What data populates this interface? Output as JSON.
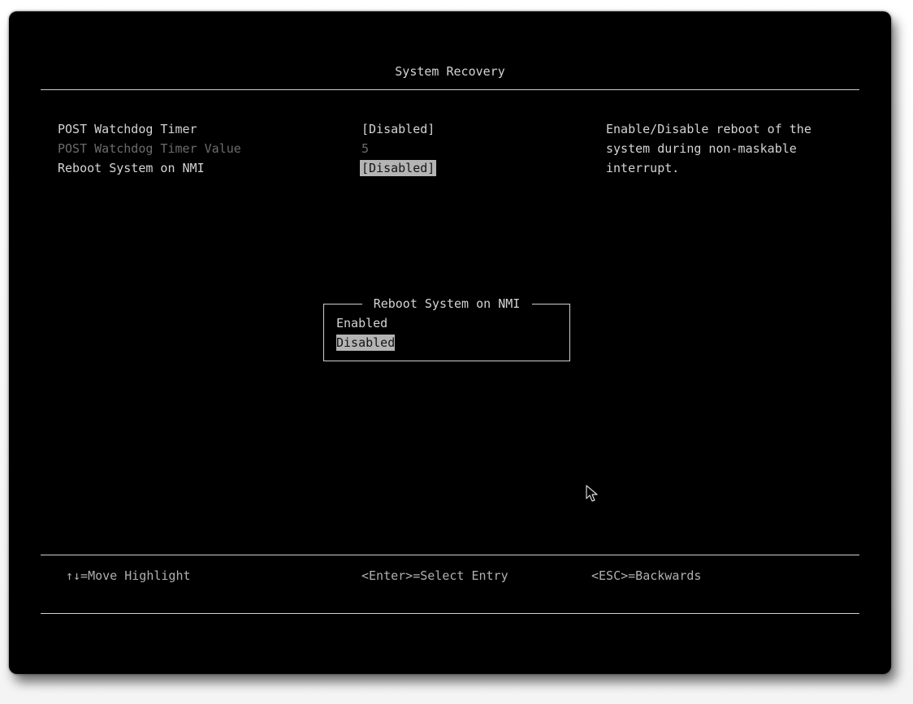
{
  "screen": {
    "title": "System Recovery"
  },
  "settings": [
    {
      "label": "POST Watchdog Timer",
      "value": "[Disabled]",
      "state": "normal"
    },
    {
      "label": "POST Watchdog Timer Value",
      "value": "5",
      "state": "disabled"
    },
    {
      "label": "Reboot System on NMI",
      "value": "[Disabled]",
      "state": "selected"
    }
  ],
  "help": {
    "lines": [
      "Enable/Disable reboot of the",
      "system during non-maskable",
      "interrupt."
    ]
  },
  "popup": {
    "title": "Reboot System on NMI",
    "options": [
      {
        "label": "Enabled",
        "highlighted": false
      },
      {
        "label": "Disabled",
        "highlighted": true
      }
    ]
  },
  "footer": {
    "move": "↑↓=Move Highlight",
    "select": "<Enter>=Select Entry",
    "back": "<ESC>=Backwards"
  },
  "colors": {
    "background": "#000000",
    "text": "#d4d4d4",
    "dimmed_text": "#6c6c6c",
    "highlight_bg": "#b4b4b4",
    "highlight_text": "#141414"
  },
  "icons": {
    "pointer": "mouse-pointer-icon"
  }
}
